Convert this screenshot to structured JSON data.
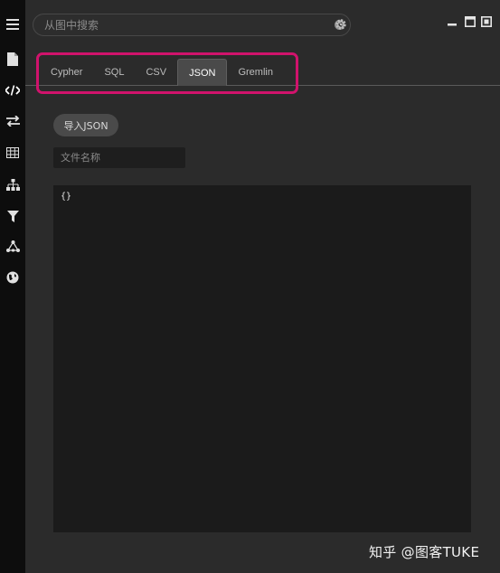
{
  "search": {
    "placeholder": "从图中搜索"
  },
  "tabs": [
    {
      "label": "Cypher",
      "active": false
    },
    {
      "label": "SQL",
      "active": false
    },
    {
      "label": "CSV",
      "active": false
    },
    {
      "label": "JSON",
      "active": true
    },
    {
      "label": "Gremlin",
      "active": false
    }
  ],
  "json_panel": {
    "import_button_label": "导入JSON",
    "filename_placeholder": "文件名称",
    "editor_value": "{}"
  },
  "sidebar": {
    "items": [
      {
        "icon": "menu-icon"
      },
      {
        "icon": "document-icon"
      },
      {
        "icon": "code-icon",
        "active": true
      },
      {
        "icon": "swap-icon"
      },
      {
        "icon": "table-icon"
      },
      {
        "icon": "hierarchy-icon"
      },
      {
        "icon": "filter-icon"
      },
      {
        "icon": "graph-icon"
      },
      {
        "icon": "globe-icon"
      }
    ]
  },
  "watermark": "知乎 @图客TUKE",
  "colors": {
    "highlight": "#d0136c",
    "rail_bg": "#0d0d0d",
    "panel_bg": "#2b2b2b",
    "editor_bg": "#1b1b1b",
    "active_tab_bg": "#4a4a4a"
  }
}
